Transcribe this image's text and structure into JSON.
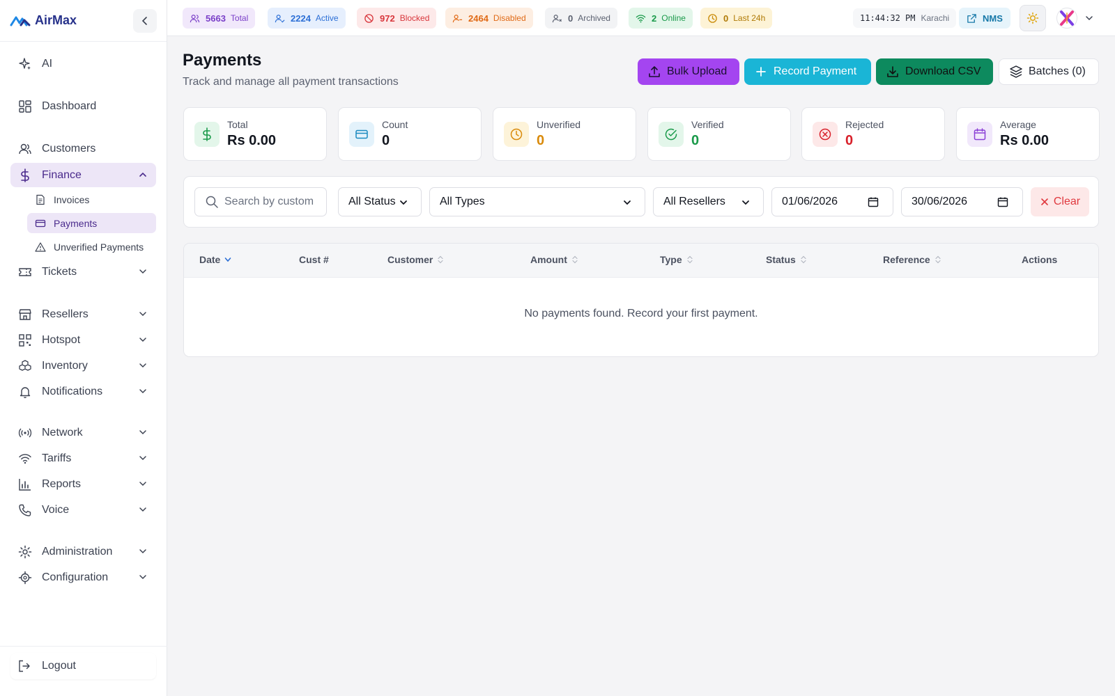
{
  "brand": {
    "name": "AirMax"
  },
  "sidebar": {
    "items": [
      {
        "label": "AI"
      },
      {
        "label": "Dashboard"
      },
      {
        "label": "Customers"
      },
      {
        "label": "Finance"
      },
      {
        "label": "Tickets"
      },
      {
        "label": "Resellers"
      },
      {
        "label": "Hotspot"
      },
      {
        "label": "Inventory"
      },
      {
        "label": "Notifications"
      },
      {
        "label": "Network"
      },
      {
        "label": "Tariffs"
      },
      {
        "label": "Reports"
      },
      {
        "label": "Voice"
      },
      {
        "label": "Administration"
      },
      {
        "label": "Configuration"
      }
    ],
    "finance_sub": [
      {
        "label": "Invoices"
      },
      {
        "label": "Payments"
      },
      {
        "label": "Unverified Payments"
      }
    ],
    "logout": "Logout"
  },
  "topbar": {
    "stats": [
      {
        "value": "5663",
        "label": "Total"
      },
      {
        "value": "2224",
        "label": "Active"
      },
      {
        "value": "972",
        "label": "Blocked"
      },
      {
        "value": "2464",
        "label": "Disabled"
      },
      {
        "value": "0",
        "label": "Archived"
      },
      {
        "value": "2",
        "label": "Online"
      },
      {
        "value": "0",
        "label": "Last 24h"
      }
    ],
    "time": "11:44:32 PM",
    "timezone": "Karachi",
    "nms": "NMS"
  },
  "page": {
    "title": "Payments",
    "subtitle": "Track and manage all payment transactions",
    "buttons": {
      "bulk_upload": "Bulk Upload",
      "record_payment": "Record Payment",
      "download_csv": "Download CSV",
      "batches": "Batches (0)"
    }
  },
  "stats": [
    {
      "label": "Total",
      "value": "Rs 0.00",
      "color": "#12161f"
    },
    {
      "label": "Count",
      "value": "0",
      "color": "#12161f"
    },
    {
      "label": "Unverified",
      "value": "0",
      "color": "#d98a0b"
    },
    {
      "label": "Verified",
      "value": "0",
      "color": "#1a9a4a"
    },
    {
      "label": "Rejected",
      "value": "0",
      "color": "#d8202a"
    },
    {
      "label": "Average",
      "value": "Rs 0.00",
      "color": "#12161f"
    }
  ],
  "filters": {
    "search_placeholder": "Search by custom",
    "status": "All Status",
    "type": "All Types",
    "resellers": "All Resellers",
    "date_from": "01/06/2026",
    "date_to": "30/06/2026",
    "clear": "Clear"
  },
  "table": {
    "columns": [
      "Date",
      "Cust #",
      "Customer",
      "Amount",
      "Type",
      "Status",
      "Reference",
      "Actions"
    ],
    "empty_message": "No payments found. Record your first payment."
  }
}
